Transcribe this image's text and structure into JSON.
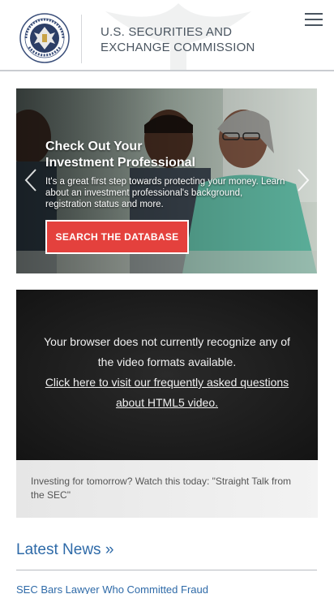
{
  "header": {
    "agency_line1": "U.S. SECURITIES AND",
    "agency_line2": "EXCHANGE COMMISSION",
    "menu_icon": "hamburger-menu-icon"
  },
  "carousel": {
    "title_line1": "Check Out Your",
    "title_line2": "Investment Professional",
    "body": "It's a great first step towards protecting your money. Learn about an investment professional's background, registration status and more.",
    "cta_label": "SEARCH THE DATABASE",
    "prev_icon": "chevron-left-icon",
    "next_icon": "chevron-right-icon"
  },
  "video": {
    "unsupported_text": "Your browser does not currently recognize any of the video formats available.",
    "help_link": "Click here to visit our frequently asked questions about HTML5 video.",
    "caption": "Investing for tomorrow? Watch this today: \"Straight Talk from the SEC\""
  },
  "news": {
    "heading": "Latest News »",
    "items": [
      {
        "title": "SEC Bars Lawyer Who Committed Fraud"
      }
    ]
  },
  "colors": {
    "link_blue": "#2e6aa8",
    "cta_red": "#e4413d",
    "header_text": "#4a5560"
  }
}
